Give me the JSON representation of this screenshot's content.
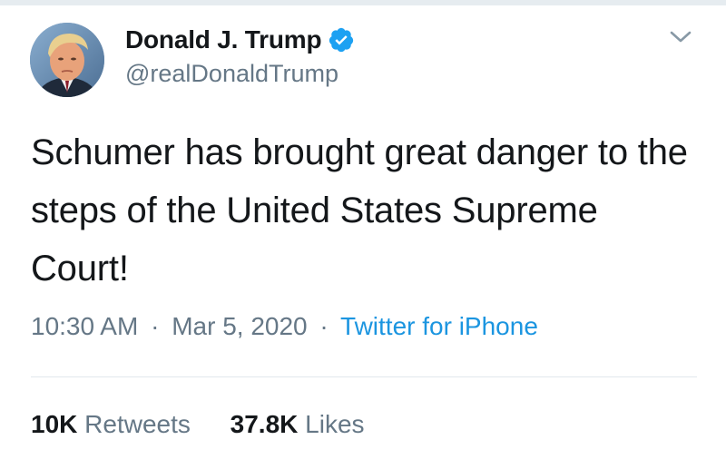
{
  "author": {
    "display_name": "Donald J. Trump",
    "handle": "@realDonaldTrump",
    "verified": true,
    "avatar_icon": "profile-photo"
  },
  "tweet": {
    "text": "Schumer has brought great danger to the steps of the United States Supreme Court!",
    "time": "10:30 AM",
    "date": "Mar 5, 2020",
    "separator": "·",
    "source": "Twitter for iPhone"
  },
  "stats": {
    "retweets_count": "10K",
    "retweets_label": "Retweets",
    "likes_count": "37.8K",
    "likes_label": "Likes"
  },
  "colors": {
    "text": "#14171a",
    "secondary": "#657786",
    "link": "#1b95e0",
    "verified_badge": "#1da1f2"
  },
  "icons": {
    "menu": "chevron-down-icon",
    "verified": "verified-badge-icon"
  }
}
